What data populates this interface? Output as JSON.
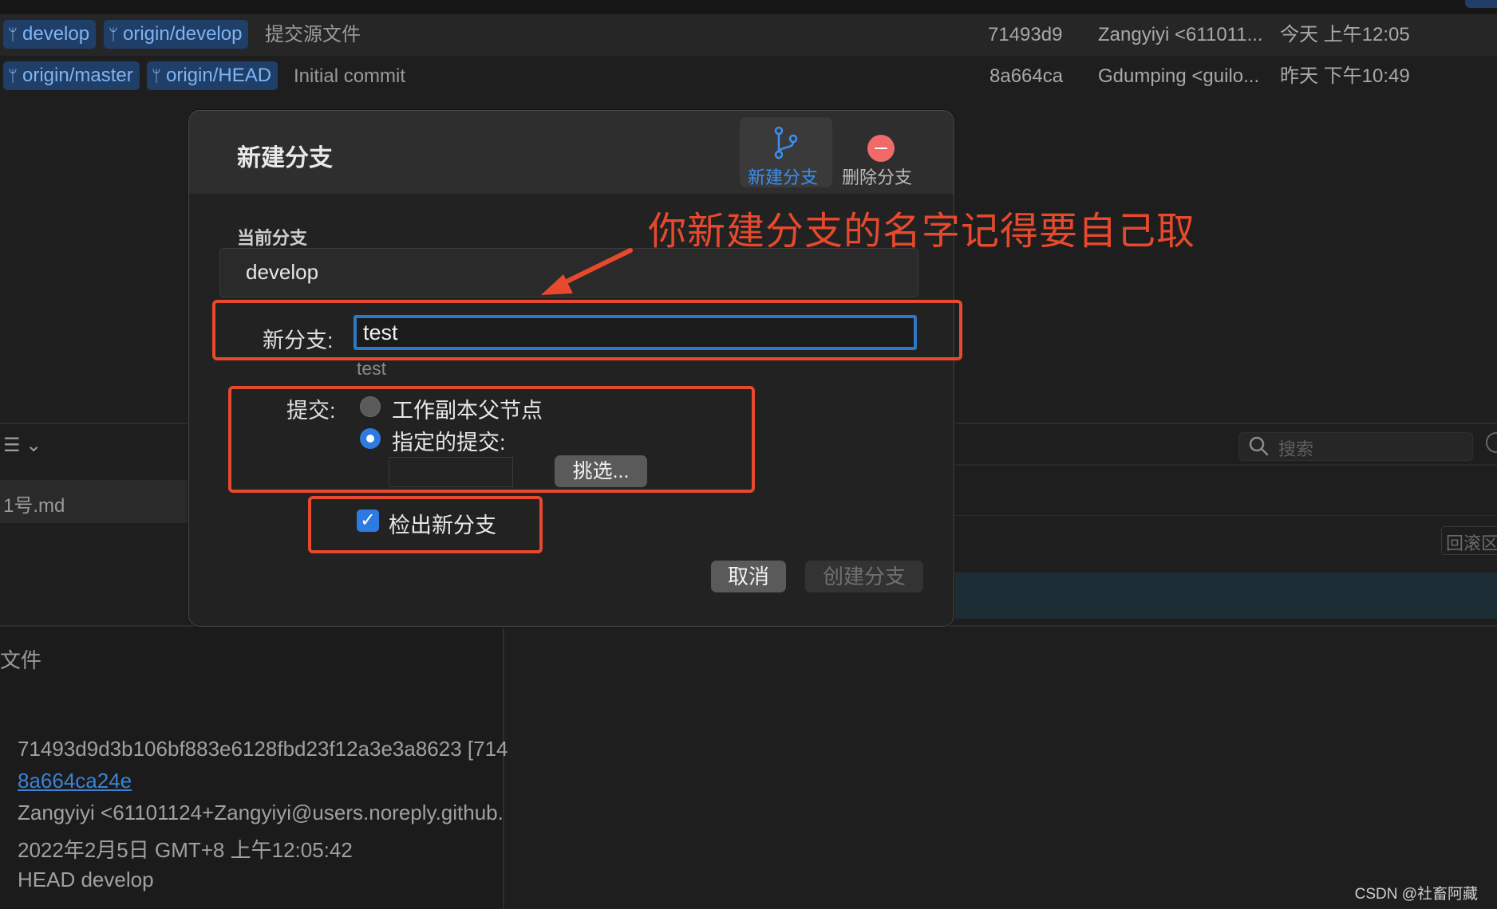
{
  "commits": [
    {
      "tags": [
        "develop",
        "origin/develop"
      ],
      "message": "提交源文件",
      "hash": "71493d9",
      "author": "Zangyiyi <611011...",
      "date": "今天 上午12:05"
    },
    {
      "tags": [
        "origin/master",
        "origin/HEAD"
      ],
      "message": "Initial commit",
      "hash": "8a664ca",
      "author": "Gdumping <guilo...",
      "date": "昨天 下午10:49"
    }
  ],
  "background": {
    "list_icon": "☰ ⌄",
    "file_item": "1号.md",
    "search_placeholder": "搜索",
    "scroll_label": "回滚区",
    "partial_label": "文件",
    "detail_hash": "71493d9d3b106bf883e6128fbd23f12a3e3a8623 [714",
    "detail_parent": "8a664ca24e",
    "detail_author": "Zangyiyi <61101124+Zangyiyi@users.noreply.github.",
    "detail_date": "2022年2月5日 GMT+8 上午12:05:42",
    "detail_refs": "HEAD develop"
  },
  "dialog": {
    "title": "新建分支",
    "seg_new_label": "新建分支",
    "seg_delete_label": "删除分支",
    "current_branch_label": "当前分支",
    "current_branch_value": "develop",
    "new_branch_label": "新分支:",
    "new_branch_value": "test",
    "new_branch_hint": "test",
    "commit_label": "提交:",
    "radio_working_copy": "工作副本父节点",
    "radio_specified": "指定的提交:",
    "pick_button": "挑选...",
    "checkout_label": "检出新分支",
    "checkout_checked": true,
    "cancel_button": "取消",
    "create_button": "创建分支"
  },
  "annotation": {
    "text": "你新建分支的名字记得要自己取",
    "color": "#e6492d"
  },
  "watermark": "CSDN @社畜阿藏",
  "colors": {
    "accent": "#2d7be0",
    "tag_bg": "#1f3f69",
    "tag_fg": "#7fb4f2",
    "delete_icon": "#f06a6a"
  }
}
